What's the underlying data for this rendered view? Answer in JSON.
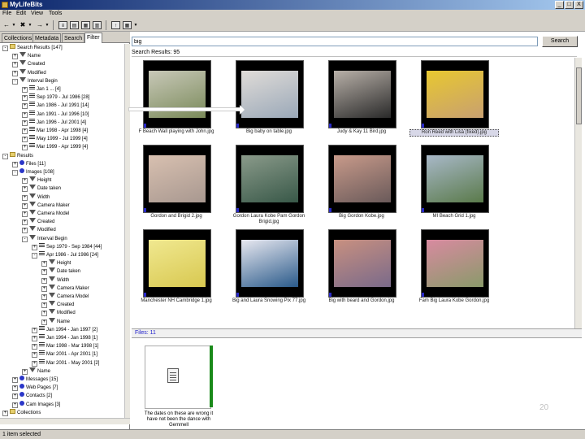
{
  "window": {
    "title": "MyLifeBits",
    "min": "_",
    "max": "□",
    "close": "X"
  },
  "menu": [
    "File",
    "Edit",
    "View",
    "Tools"
  ],
  "left_tabs": [
    "Collections",
    "Metadata",
    "Search",
    "Filter"
  ],
  "tree": [
    {
      "indent": 0,
      "icon": "folder",
      "expander": "-",
      "label": "Search Results [147]"
    },
    {
      "indent": 1,
      "icon": "funnel",
      "expander": "+",
      "label": "Name"
    },
    {
      "indent": 1,
      "icon": "funnel",
      "expander": "+",
      "label": "Created"
    },
    {
      "indent": 1,
      "icon": "funnel",
      "expander": "+",
      "label": "Modified"
    },
    {
      "indent": 1,
      "icon": "funnel",
      "expander": "-",
      "label": "Interval Begin"
    },
    {
      "indent": 2,
      "icon": "range",
      "expander": "+",
      "label": "Jan 1 ... [4]"
    },
    {
      "indent": 2,
      "icon": "range",
      "expander": "+",
      "label": "Sep 1979 - Jul 1986 [28]"
    },
    {
      "indent": 2,
      "icon": "range",
      "expander": "+",
      "label": "Jan 1986 - Jul 1991 [14]"
    },
    {
      "indent": 2,
      "icon": "range",
      "expander": "+",
      "label": "Jan 1991 - Jul 1996 [10]"
    },
    {
      "indent": 2,
      "icon": "range",
      "expander": "+",
      "label": "Jan 1996 - Jul 2001 [4]"
    },
    {
      "indent": 2,
      "icon": "range",
      "expander": "+",
      "label": "Mar 1998 - Apr 1998 [4]"
    },
    {
      "indent": 2,
      "icon": "range",
      "expander": "+",
      "label": "May 1999 - Jul 1999 [4]"
    },
    {
      "indent": 2,
      "icon": "range",
      "expander": "+",
      "label": "Mar 1999 - Apr 1999 [4]"
    },
    {
      "indent": 0,
      "icon": "folder",
      "expander": "-",
      "label": "Results"
    },
    {
      "indent": 1,
      "icon": "dot",
      "expander": "+",
      "label": "Files [11]"
    },
    {
      "indent": 1,
      "icon": "dot",
      "expander": "-",
      "label": "Images [108]"
    },
    {
      "indent": 2,
      "icon": "funnel",
      "expander": "+",
      "label": "Height"
    },
    {
      "indent": 2,
      "icon": "funnel",
      "expander": "+",
      "label": "Date taken"
    },
    {
      "indent": 2,
      "icon": "funnel",
      "expander": "+",
      "label": "Width"
    },
    {
      "indent": 2,
      "icon": "funnel",
      "expander": "+",
      "label": "Camera Maker"
    },
    {
      "indent": 2,
      "icon": "funnel",
      "expander": "+",
      "label": "Camera Model"
    },
    {
      "indent": 2,
      "icon": "funnel",
      "expander": "+",
      "label": "Created"
    },
    {
      "indent": 2,
      "icon": "funnel",
      "expander": "+",
      "label": "Modified"
    },
    {
      "indent": 2,
      "icon": "funnel",
      "expander": "-",
      "label": "Interval Begin"
    },
    {
      "indent": 3,
      "icon": "range",
      "expander": "+",
      "label": "Sep 1979 - Sep 1984 [44]"
    },
    {
      "indent": 3,
      "icon": "range",
      "expander": "-",
      "label": "Apr 1986 - Jul 1986 [24]"
    },
    {
      "indent": 4,
      "icon": "funnel",
      "expander": "+",
      "label": "Height"
    },
    {
      "indent": 4,
      "icon": "funnel",
      "expander": "+",
      "label": "Date taken"
    },
    {
      "indent": 4,
      "icon": "funnel",
      "expander": "+",
      "label": "Width"
    },
    {
      "indent": 4,
      "icon": "funnel",
      "expander": "+",
      "label": "Camera Maker"
    },
    {
      "indent": 4,
      "icon": "funnel",
      "expander": "+",
      "label": "Camera Model"
    },
    {
      "indent": 4,
      "icon": "funnel",
      "expander": "+",
      "label": "Created"
    },
    {
      "indent": 4,
      "icon": "funnel",
      "expander": "+",
      "label": "Modified"
    },
    {
      "indent": 4,
      "icon": "funnel",
      "expander": "+",
      "label": "Name"
    },
    {
      "indent": 3,
      "icon": "range",
      "expander": "+",
      "label": "Jan 1994 - Jan 1997 [2]"
    },
    {
      "indent": 3,
      "icon": "range",
      "expander": "+",
      "label": "Jan 1994 - Jan 1998 [1]"
    },
    {
      "indent": 3,
      "icon": "range",
      "expander": "+",
      "label": "Mar 1998 - Mar 1998 [1]"
    },
    {
      "indent": 3,
      "icon": "range",
      "expander": "+",
      "label": "Mar 2001 - Apr 2001 [1]"
    },
    {
      "indent": 3,
      "icon": "range",
      "expander": "+",
      "label": "Mar 2001 - May 2001 [2]"
    },
    {
      "indent": 2,
      "icon": "funnel",
      "expander": "+",
      "label": "Name"
    },
    {
      "indent": 1,
      "icon": "dot",
      "expander": "+",
      "label": "Messages [15]"
    },
    {
      "indent": 1,
      "icon": "dot",
      "expander": "+",
      "label": "Web Pages [7]"
    },
    {
      "indent": 1,
      "icon": "dot",
      "expander": "+",
      "label": "Contacts [2]"
    },
    {
      "indent": 1,
      "icon": "dot",
      "expander": "+",
      "label": "Cam Images [3]"
    },
    {
      "indent": 0,
      "icon": "folder",
      "expander": "+",
      "label": "Collections"
    }
  ],
  "search": {
    "query": "big",
    "button": "Search"
  },
  "results_header": "Search Results: 95",
  "photos": [
    {
      "caption": "F Beach Wall playing with John.jpg",
      "colors": [
        "#7a8a5a",
        "#c8c8b8"
      ],
      "selected": false
    },
    {
      "caption": "Big baby on table.jpg",
      "colors": [
        "#9aa8b8",
        "#e0dcd8"
      ],
      "selected": false
    },
    {
      "caption": "Judy & Kay 11 Bird.jpg",
      "colors": [
        "#2a2a2a",
        "#b8b0a8"
      ],
      "selected": false
    },
    {
      "caption": "Ron Reed with Lisa (fixed).jpg",
      "colors": [
        "#c8a070",
        "#e8c830"
      ],
      "selected": true
    },
    {
      "caption": "Gordon and Brigid 2.jpg",
      "colors": [
        "#a89890",
        "#d8c0b0"
      ],
      "selected": false
    },
    {
      "caption": "Gordon Laura Kobe Pam Gordon Brigid.jpg",
      "colors": [
        "#385848",
        "#8a9a8a"
      ],
      "selected": false
    },
    {
      "caption": "Big Gordon Kobe.jpg",
      "colors": [
        "#6a5a5a",
        "#c89a8a"
      ],
      "selected": false
    },
    {
      "caption": "MI Beach Grid 1.jpg",
      "colors": [
        "#5a7a4a",
        "#a8b8c8"
      ],
      "selected": false
    },
    {
      "caption": "Manchester NH Cambridge 1.jpg",
      "colors": [
        "#d8c850",
        "#f0e890"
      ],
      "selected": false
    },
    {
      "caption": "Big and Laura Snowing Pix 77.jpg",
      "colors": [
        "#2a5a8a",
        "#e8e8f0"
      ],
      "selected": false
    },
    {
      "caption": "Big with beard and Gordon.jpg",
      "colors": [
        "#7a6a8a",
        "#c89080"
      ],
      "selected": false
    },
    {
      "caption": "Fam Big Laura Kobe Gordon.jpg",
      "colors": [
        "#8a9a6a",
        "#d88aa0"
      ],
      "selected": false
    }
  ],
  "bottom_tab": "Files: 11",
  "bottom_doc_caption": "The dates on these are wrong it have not been the dance with Gemmell",
  "page_number": "20",
  "status": "1 item selected"
}
